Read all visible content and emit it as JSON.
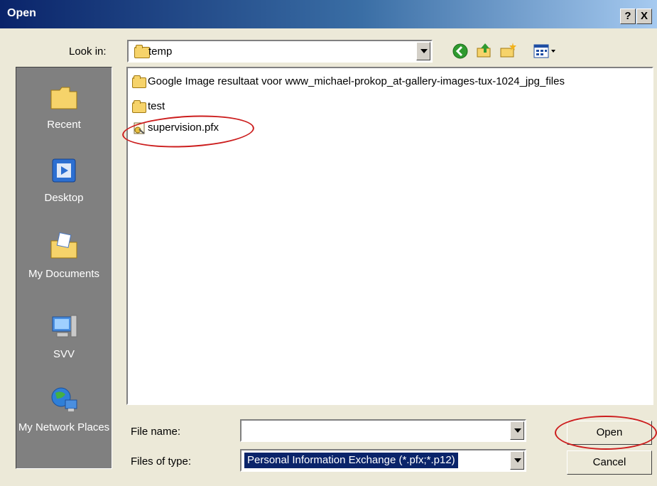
{
  "window": {
    "title": "Open",
    "help_label": "?",
    "close_label": "X"
  },
  "lookin": {
    "label": "Look in:",
    "value": "temp"
  },
  "toolbar": {
    "icons": [
      "back-icon",
      "up-folder-icon",
      "new-folder-icon",
      "views-menu-icon"
    ]
  },
  "places": [
    {
      "label": "Recent",
      "icon": "recent-folder-icon"
    },
    {
      "label": "Desktop",
      "icon": "desktop-icon"
    },
    {
      "label": "My Documents",
      "icon": "my-documents-icon"
    },
    {
      "label": "SVV",
      "icon": "computer-icon"
    },
    {
      "label": "My Network Places",
      "icon": "network-icon"
    }
  ],
  "files": [
    {
      "name": "Google Image resultaat voor www_michael-prokop_at-gallery-images-tux-1024_jpg_files",
      "type": "folder"
    },
    {
      "name": "test",
      "type": "folder"
    },
    {
      "name": "supervision.pfx",
      "type": "pfx-file"
    }
  ],
  "filename": {
    "label": "File name:",
    "value": ""
  },
  "filetype": {
    "label": "Files of type:",
    "value": "Personal Information Exchange (*.pfx;*.p12)"
  },
  "buttons": {
    "open": "Open",
    "cancel": "Cancel"
  },
  "annotation_color": "#cc1d1d"
}
